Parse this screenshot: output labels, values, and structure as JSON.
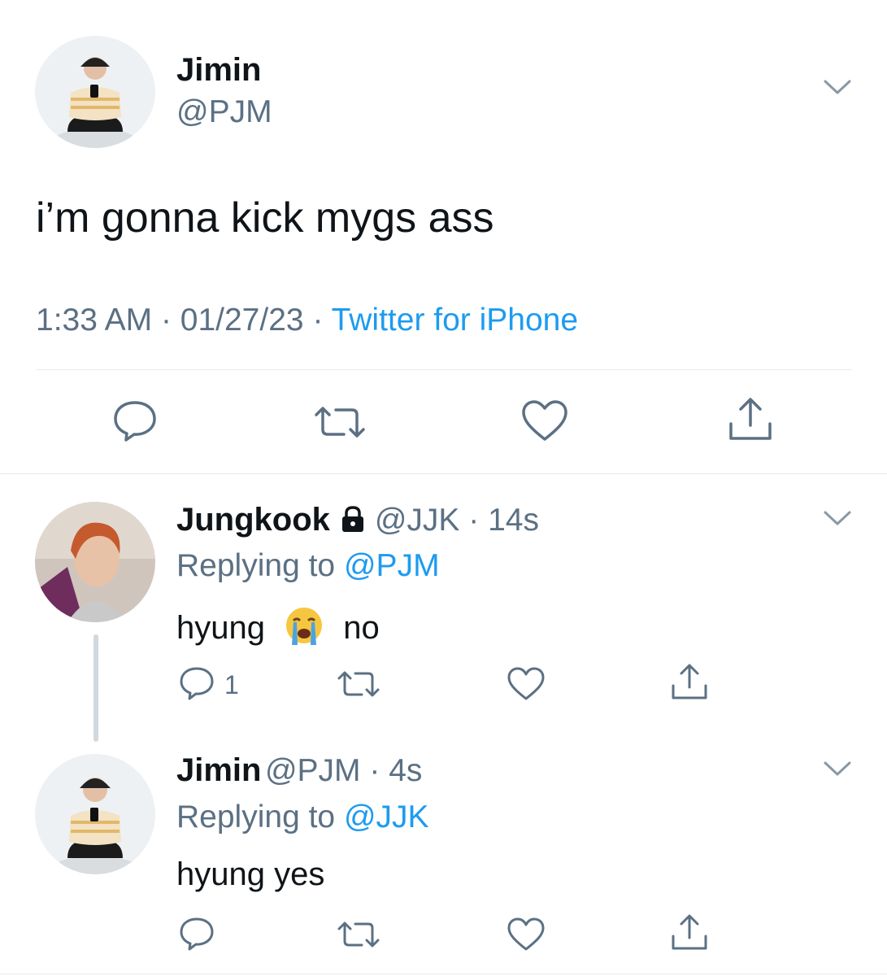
{
  "main_tweet": {
    "author_name": "Jimin",
    "author_handle": "@PJM",
    "text": "i’m gonna kick mygs ass",
    "time": "1:33 AM",
    "date": "01/27/23",
    "source": "Twitter for iPhone",
    "sep": "·"
  },
  "replies": [
    {
      "author_name": "Jungkook",
      "author_handle": "@JJK",
      "age": "14s",
      "replying_prefix": "Replying to",
      "replying_to": "@PJM",
      "text_before": "hyung",
      "emoji": "😭",
      "text_after": "no",
      "reply_count": "1",
      "protected": true
    },
    {
      "author_name": "Jimin",
      "author_handle": "@PJM",
      "age": "4s",
      "replying_prefix": "Replying to",
      "replying_to": "@JJK",
      "text": "hyung yes"
    }
  ],
  "colors": {
    "link": "#1d9bf0",
    "secondary": "#5b7083",
    "divider": "#e6ecf0",
    "icon": "#5b7083"
  },
  "icons": [
    "chevron-down-icon",
    "reply-icon",
    "retweet-icon",
    "like-icon",
    "share-icon",
    "lock-icon"
  ]
}
